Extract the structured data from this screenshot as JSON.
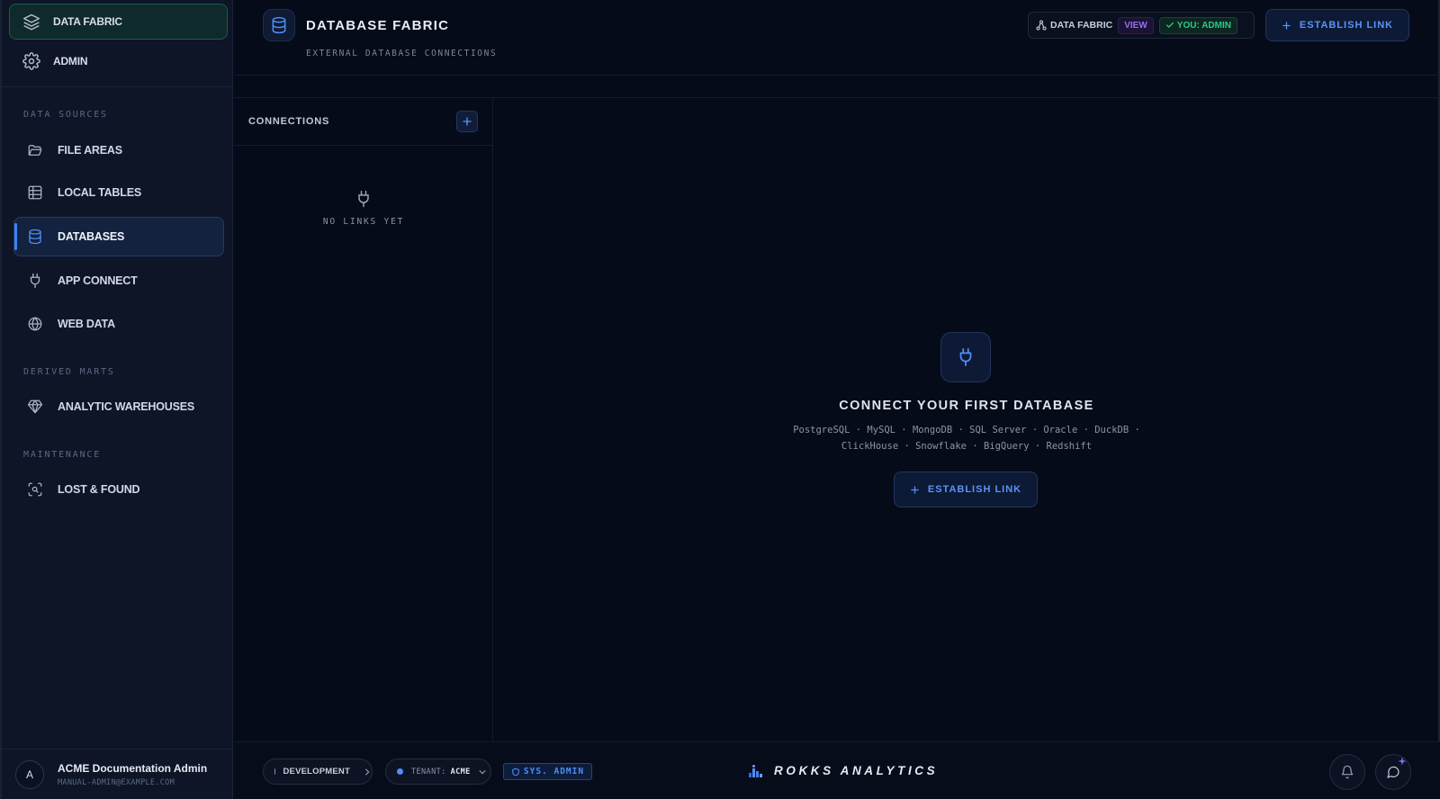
{
  "sidebar": {
    "top": [
      {
        "label": "DATA FABRIC",
        "icon": "layers-icon",
        "active": true
      },
      {
        "label": "ADMIN",
        "icon": "gear-icon",
        "active": false
      }
    ],
    "sections": [
      {
        "label": "DATA SOURCES"
      },
      {
        "label": "DERIVED MARTS"
      },
      {
        "label": "MAINTENANCE"
      }
    ],
    "items": [
      {
        "label": "FILE AREAS",
        "icon": "folder-open-icon"
      },
      {
        "label": "LOCAL TABLES",
        "icon": "table-grid-icon"
      },
      {
        "label": "DATABASES",
        "icon": "database-icon",
        "active": true
      },
      {
        "label": "APP CONNECT",
        "icon": "plug-icon"
      },
      {
        "label": "WEB DATA",
        "icon": "globe-icon"
      },
      {
        "label": "ANALYTIC WAREHOUSES",
        "icon": "gem-icon"
      },
      {
        "label": "LOST & FOUND",
        "icon": "scan-search-icon"
      }
    ],
    "user": {
      "initial": "A",
      "name": "ACME Documentation Admin",
      "email": "MANUAL-ADMIN@EXAMPLE.COM"
    }
  },
  "header": {
    "title": "DATABASE FABRIC",
    "subtitle": "EXTERNAL DATABASE CONNECTIONS",
    "permission": {
      "scope": "DATA FABRIC",
      "level": "VIEW",
      "role": "YOU: ADMIN"
    },
    "establish_label": "ESTABLISH LINK"
  },
  "connections": {
    "title": "CONNECTIONS",
    "empty_text": "NO LINKS YET"
  },
  "main": {
    "title": "CONNECT YOUR FIRST DATABASE",
    "db_line1": "PostgreSQL · MySQL · MongoDB · SQL Server · Oracle · DuckDB ·",
    "db_line2": "ClickHouse · Snowflake · BigQuery · Redshift",
    "establish_label": "ESTABLISH LINK"
  },
  "footer": {
    "environment": "DEVELOPMENT",
    "tenant_label": "TENANT:",
    "tenant_value": "ACME",
    "sys_badge": "SYS. ADMIN",
    "brand": "ROKKS ANALYTICS"
  },
  "colors": {
    "accent": "#3b82f6",
    "success": "#2ec88a",
    "view": "#9b6bf0",
    "env_dot": "#8a93a6",
    "tenant_dot": "#4f8ef7"
  }
}
